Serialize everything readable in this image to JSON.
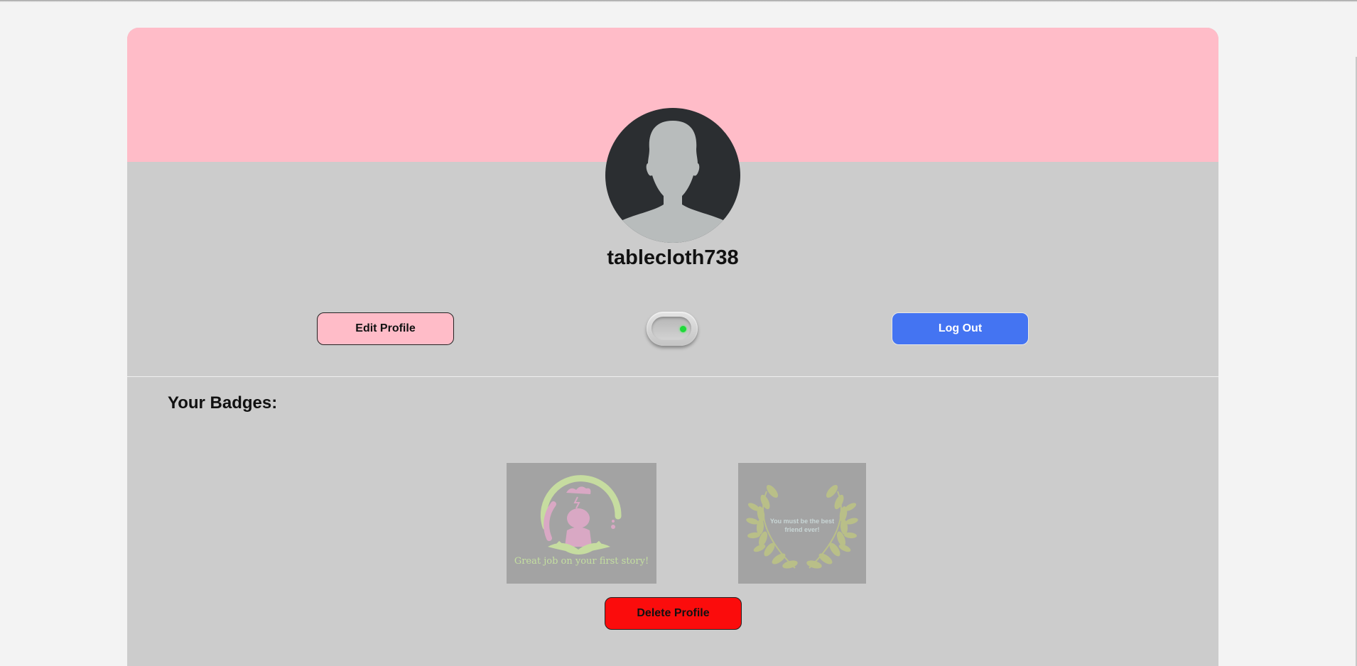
{
  "profile": {
    "username": "tablecloth738"
  },
  "actions": {
    "edit_label": "Edit Profile",
    "logout_label": "Log Out",
    "delete_label": "Delete Profile",
    "toggle_state": "on"
  },
  "badges": {
    "heading": "Your Badges:",
    "items": [
      {
        "caption": "Great job on your first story!",
        "icon": "story-badge-icon"
      },
      {
        "caption": "You must be the best friend ever!",
        "icon": "laurel-wreath-icon"
      }
    ]
  },
  "colors": {
    "banner": "#ffbcc8",
    "card": "#cccccc",
    "logout": "#4474f2",
    "delete": "#fb0c0c",
    "toggle_led": "#1fd83a"
  }
}
